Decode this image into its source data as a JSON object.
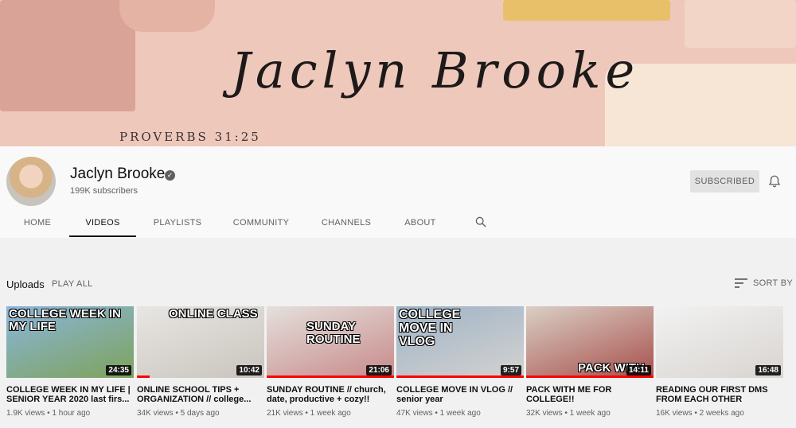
{
  "banner": {
    "title": "Jaclyn Brooke",
    "verse": "PROVERBS 31:25"
  },
  "channel": {
    "name": "Jaclyn Brooke",
    "subscribers": "199K subscribers",
    "subscribe_label": "SUBSCRIBED"
  },
  "tabs": [
    {
      "label": "HOME",
      "active": false
    },
    {
      "label": "VIDEOS",
      "active": true
    },
    {
      "label": "PLAYLISTS",
      "active": false
    },
    {
      "label": "COMMUNITY",
      "active": false
    },
    {
      "label": "CHANNELS",
      "active": false
    },
    {
      "label": "ABOUT",
      "active": false
    }
  ],
  "uploads": {
    "title": "Uploads",
    "play_all": "PLAY ALL",
    "sort_label": "SORT BY"
  },
  "videos": [
    {
      "title": "COLLEGE WEEK IN MY LIFE | SENIOR YEAR 2020 last firs...",
      "views": "1.9K views",
      "age": "1 hour ago",
      "duration": "24:35",
      "thumb_text": "COLLEGE WEEK IN MY LIFE",
      "thumb_colors": [
        "#8ab6de",
        "#7ea25a"
      ],
      "progress": 0
    },
    {
      "title": "ONLINE SCHOOL TIPS + ORGANIZATION // college...",
      "views": "34K views",
      "age": "5 days ago",
      "duration": "10:42",
      "thumb_text": "ONLINE CLASS",
      "thumb_colors": [
        "#e8e6e3",
        "#c9c4bd"
      ],
      "progress": 0.1
    },
    {
      "title": "SUNDAY ROUTINE // church, date, productive + cozy!!",
      "views": "21K views",
      "age": "1 week ago",
      "duration": "21:06",
      "thumb_text": "SUNDAY ROUTINE",
      "thumb_colors": [
        "#e4e0dc",
        "#c78a8a"
      ],
      "progress": 1
    },
    {
      "title": "COLLEGE MOVE IN VLOG // senior year",
      "views": "47K views",
      "age": "1 week ago",
      "duration": "9:57",
      "thumb_text": "COLLEGE MOVE IN VLOG",
      "thumb_colors": [
        "#9eb3c6",
        "#d4d2d0"
      ],
      "progress": 1
    },
    {
      "title": "PACK WITH ME FOR COLLEGE!!",
      "views": "32K views",
      "age": "1 week ago",
      "duration": "14:11",
      "thumb_text": "PACK WITH",
      "thumb_colors": [
        "#d9cfc5",
        "#a8504c"
      ],
      "progress": 1
    },
    {
      "title": "READING OUR FIRST DMS FROM EACH OTHER",
      "views": "16K views",
      "age": "2 weeks ago",
      "duration": "16:48",
      "thumb_text": "",
      "thumb_colors": [
        "#f2f2f2",
        "#d8d4d0"
      ],
      "progress": 0
    }
  ],
  "colors": {
    "banner_bg": "#eec8bb",
    "accent_red": "#ff0000"
  }
}
